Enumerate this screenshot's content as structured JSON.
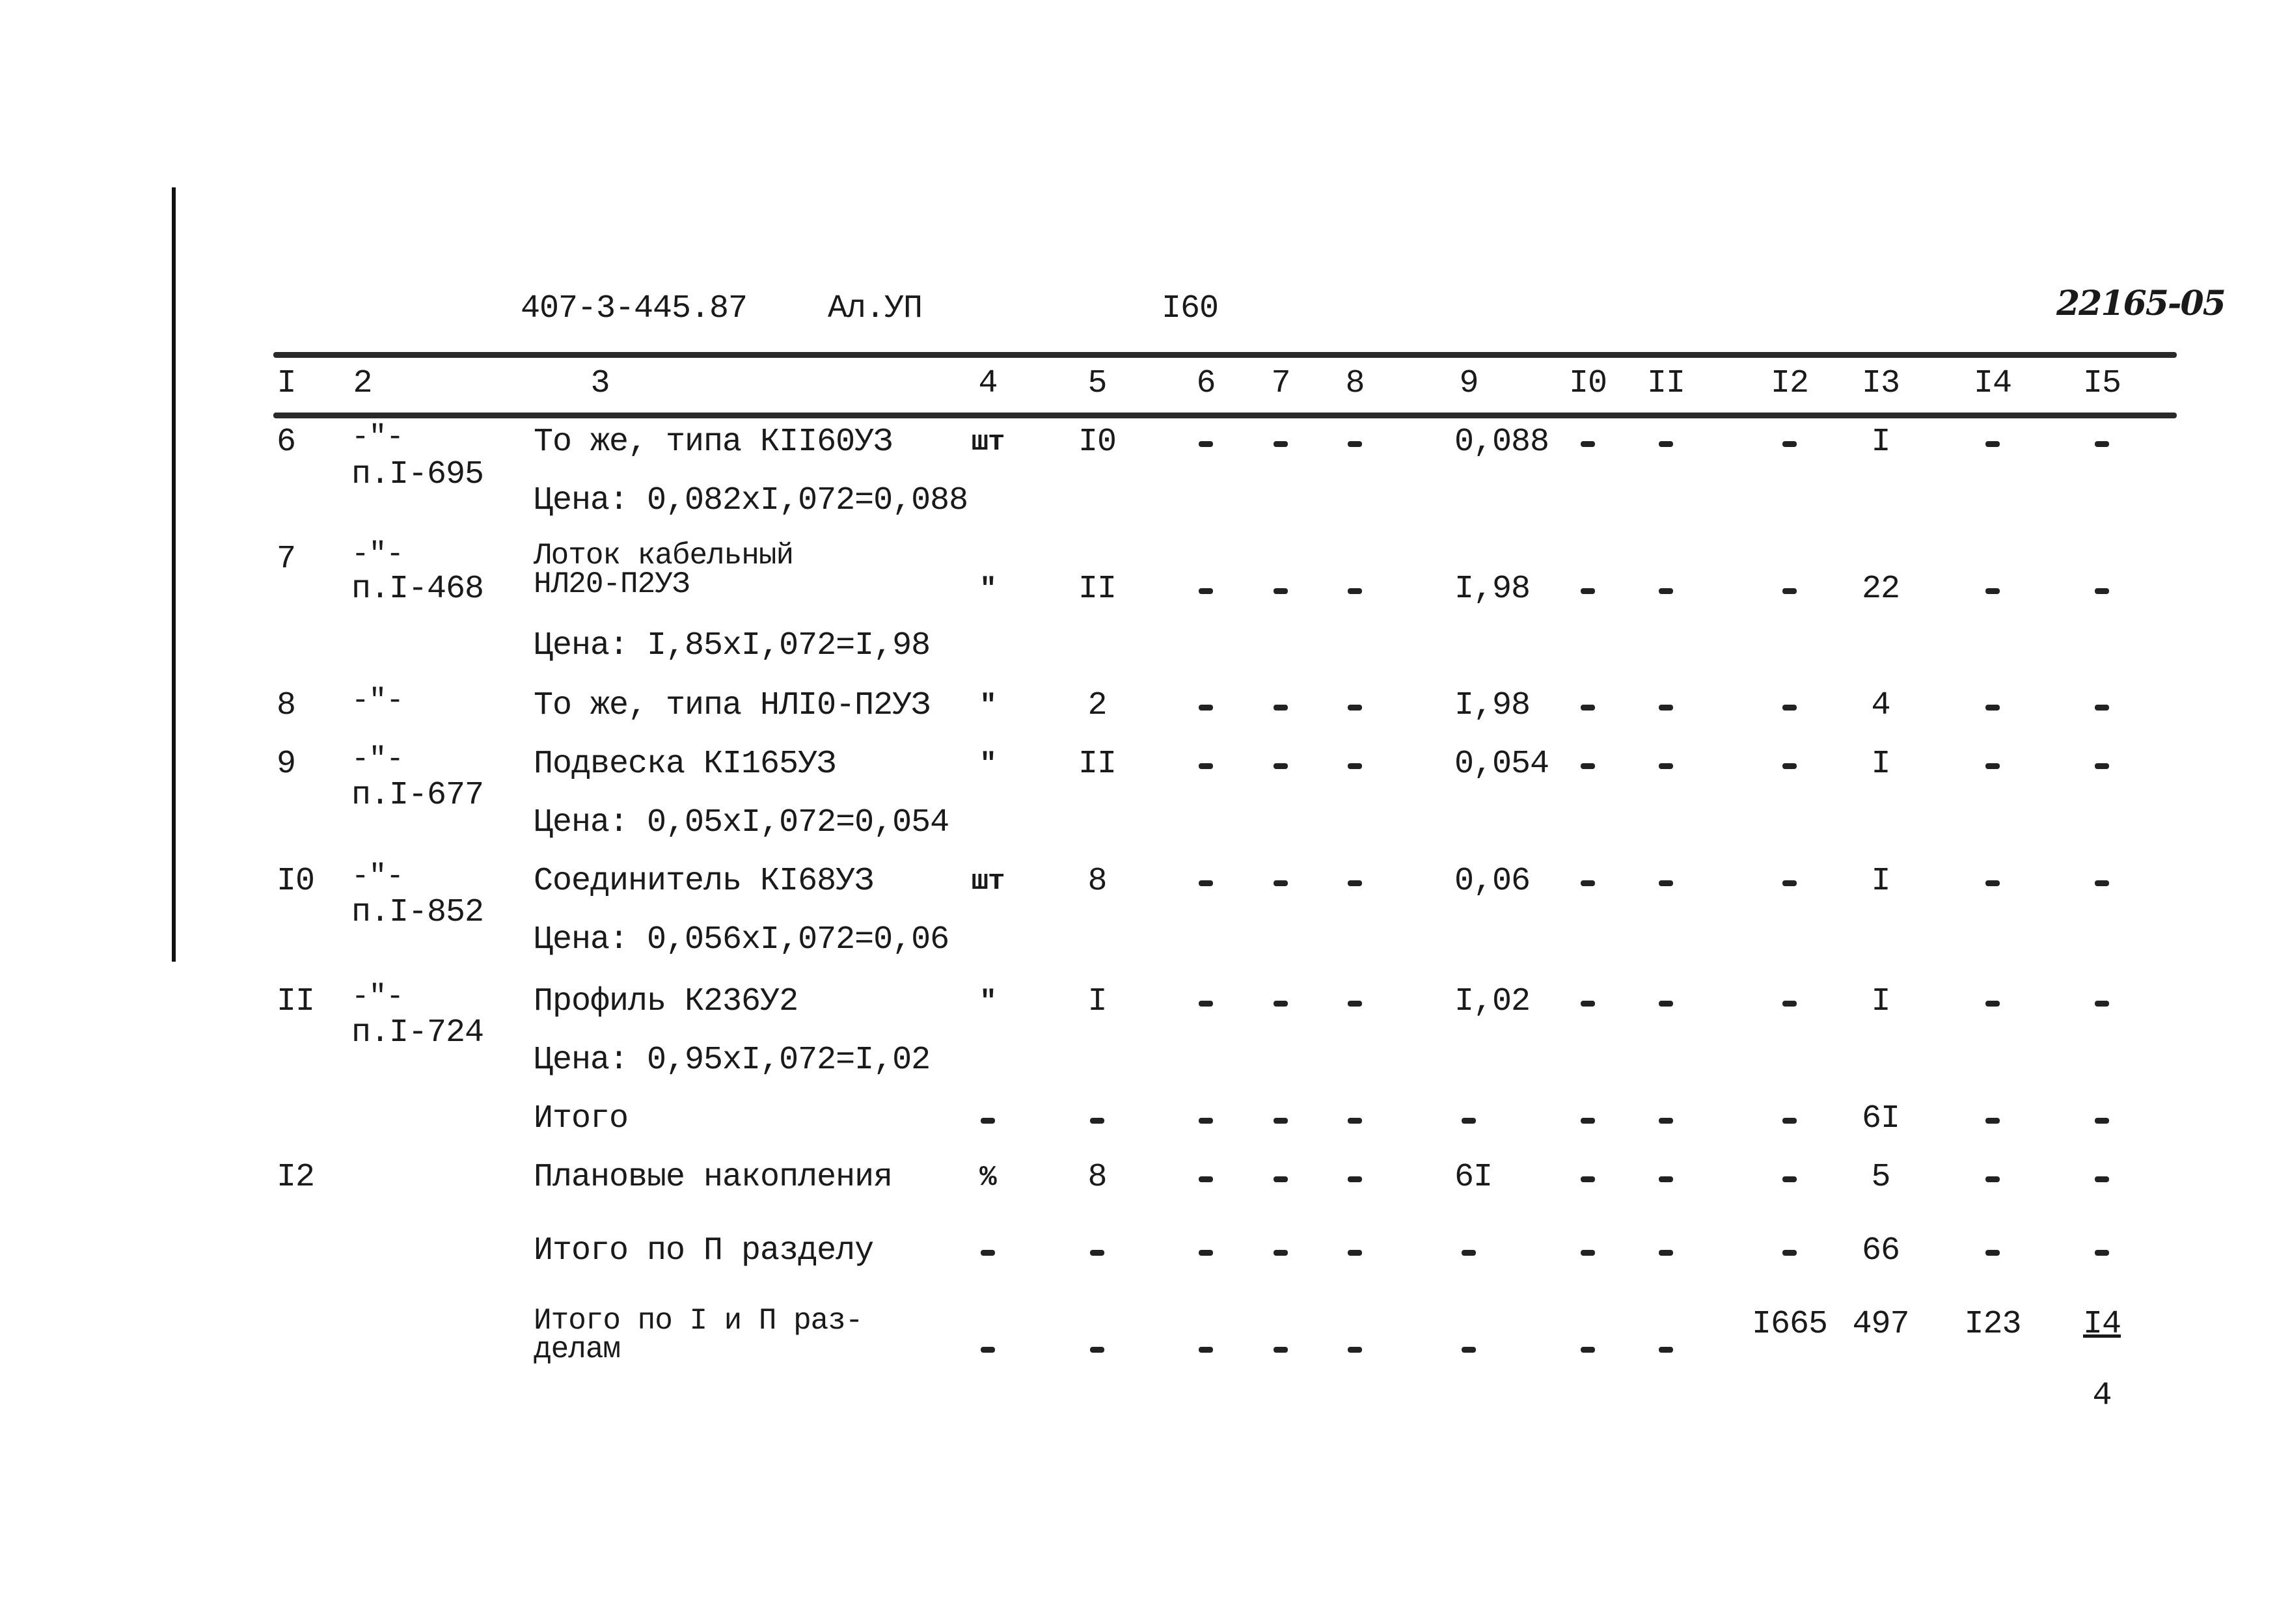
{
  "header": {
    "doc_code": "407-3-445.87",
    "album": "Ал.УП",
    "page": "I60",
    "stamp": "22165-05"
  },
  "table": {
    "column_numbers": [
      "I",
      "2",
      "3",
      "4",
      "5",
      "6",
      "7",
      "8",
      "9",
      "I0",
      "II",
      "I2",
      "I3",
      "I4",
      "I5"
    ],
    "rows": [
      {
        "no": "6",
        "ref_1": "-\"-",
        "ref_2": "п.I-695",
        "name_1": "То же, типа КII60УЗ",
        "name_2": "",
        "price_note": "Цена: 0,082хI,072=0,088",
        "unit": "шт",
        "qty": "I0",
        "c6": "-",
        "c7": "-",
        "c8": "-",
        "c9": "0,088",
        "c10": "-",
        "c11": "-",
        "c12": "-",
        "c13": "I",
        "c14": "-",
        "c15": "-"
      },
      {
        "no": "7",
        "ref_1": "-\"-",
        "ref_2": "п.I-468",
        "name_1": "Лоток кабельный",
        "name_2": "НЛ20-П2УЗ",
        "price_note": "Цена: I,85хI,072=I,98",
        "unit": "\"",
        "qty": "II",
        "c6": "-",
        "c7": "-",
        "c8": "-",
        "c9": "I,98",
        "c10": "-",
        "c11": "-",
        "c12": "-",
        "c13": "22",
        "c14": "-",
        "c15": "-"
      },
      {
        "no": "8",
        "ref_1": "-\"-",
        "ref_2": "",
        "name_1": "То же, типа НЛI0-П2УЗ",
        "name_2": "",
        "price_note": "",
        "unit": "\"",
        "qty": "2",
        "c6": "-",
        "c7": "-",
        "c8": "-",
        "c9": "I,98",
        "c10": "-",
        "c11": "-",
        "c12": "-",
        "c13": "4",
        "c14": "-",
        "c15": "-"
      },
      {
        "no": "9",
        "ref_1": "-\"-",
        "ref_2": "п.I-677",
        "name_1": "Подвеска КI165УЗ",
        "name_2": "",
        "price_note": "Цена: 0,05хI,072=0,054",
        "unit": "\"",
        "qty": "II",
        "c6": "-",
        "c7": "-",
        "c8": "-",
        "c9": "0,054",
        "c10": "-",
        "c11": "-",
        "c12": "-",
        "c13": "I",
        "c14": "-",
        "c15": "-"
      },
      {
        "no": "I0",
        "ref_1": "-\"-",
        "ref_2": "п.I-852",
        "name_1": "Соединитель КI68УЗ",
        "name_2": "",
        "price_note": "Цена: 0,056хI,072=0,06",
        "unit": "шт",
        "qty": "8",
        "c6": "-",
        "c7": "-",
        "c8": "-",
        "c9": "0,06",
        "c10": "-",
        "c11": "-",
        "c12": "-",
        "c13": "I",
        "c14": "-",
        "c15": "-"
      },
      {
        "no": "II",
        "ref_1": "-\"-",
        "ref_2": "п.I-724",
        "name_1": "Профиль К236У2",
        "name_2": "",
        "price_note": "Цена: 0,95хI,072=I,02",
        "unit": "\"",
        "qty": "I",
        "c6": "-",
        "c7": "-",
        "c8": "-",
        "c9": "I,02",
        "c10": "-",
        "c11": "-",
        "c12": "-",
        "c13": "I",
        "c14": "-",
        "c15": "-"
      }
    ],
    "subtotal": {
      "label": "Итого",
      "unit": "-",
      "qty": "-",
      "c6": "-",
      "c7": "-",
      "c8": "-",
      "c9": "-",
      "c10": "-",
      "c11": "-",
      "c12": "-",
      "c13": "6I",
      "c14": "-",
      "c15": "-"
    },
    "planned_savings": {
      "no": "I2",
      "label": "Плановые накопления",
      "unit": "%",
      "qty": "8",
      "c6": "-",
      "c7": "-",
      "c8": "-",
      "c9": "6I",
      "c10": "-",
      "c11": "-",
      "c12": "-",
      "c13": "5",
      "c14": "-",
      "c15": "-"
    },
    "total_section_2": {
      "label": "Итого по П разделу",
      "unit": "-",
      "qty": "-",
      "c6": "-",
      "c7": "-",
      "c8": "-",
      "c9": "-",
      "c10": "-",
      "c11": "-",
      "c12": "-",
      "c13": "66",
      "c14": "-",
      "c15": "-"
    },
    "total_sections_1_2": {
      "label_1": "Итого по I и П раз-",
      "label_2": "делам",
      "unit": "-",
      "qty": "-",
      "c6": "-",
      "c7": "-",
      "c8": "-",
      "c9": "-",
      "c10": "-",
      "c11": "-",
      "c12": "I665",
      "c13": "497",
      "c14": "I23",
      "c15_top": "I4",
      "c15_bottom": "4"
    }
  }
}
